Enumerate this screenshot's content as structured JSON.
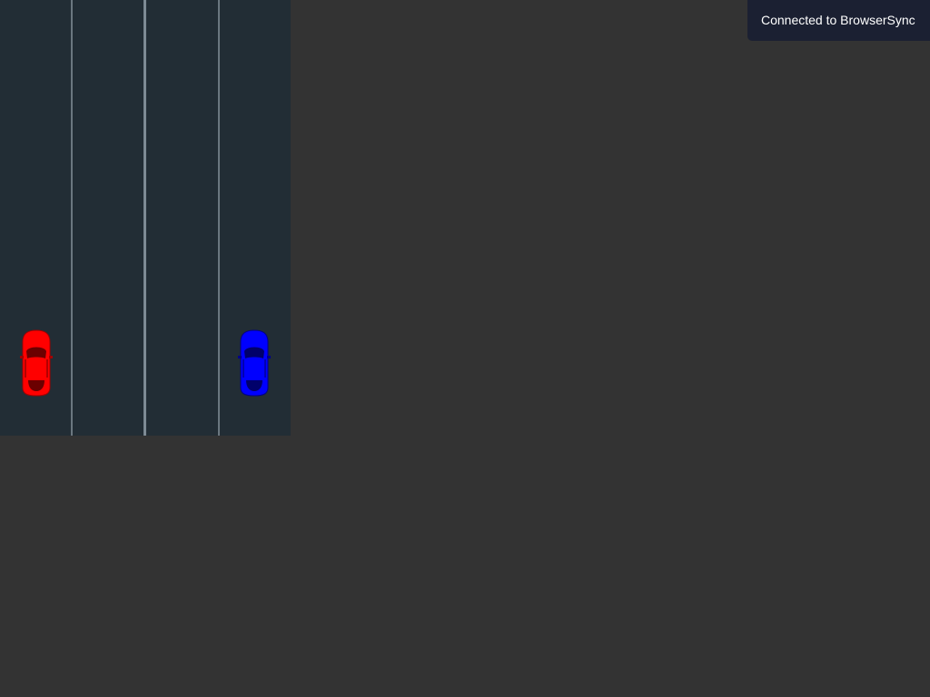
{
  "game": {
    "background": "#222d35",
    "lanes": 4,
    "cars": [
      {
        "name": "player-car",
        "color": "#ff0000",
        "lane": 1
      },
      {
        "name": "opponent-car",
        "color": "#0000ff",
        "lane": 4
      }
    ]
  },
  "notification": {
    "text": "Connected to BrowserSync"
  }
}
